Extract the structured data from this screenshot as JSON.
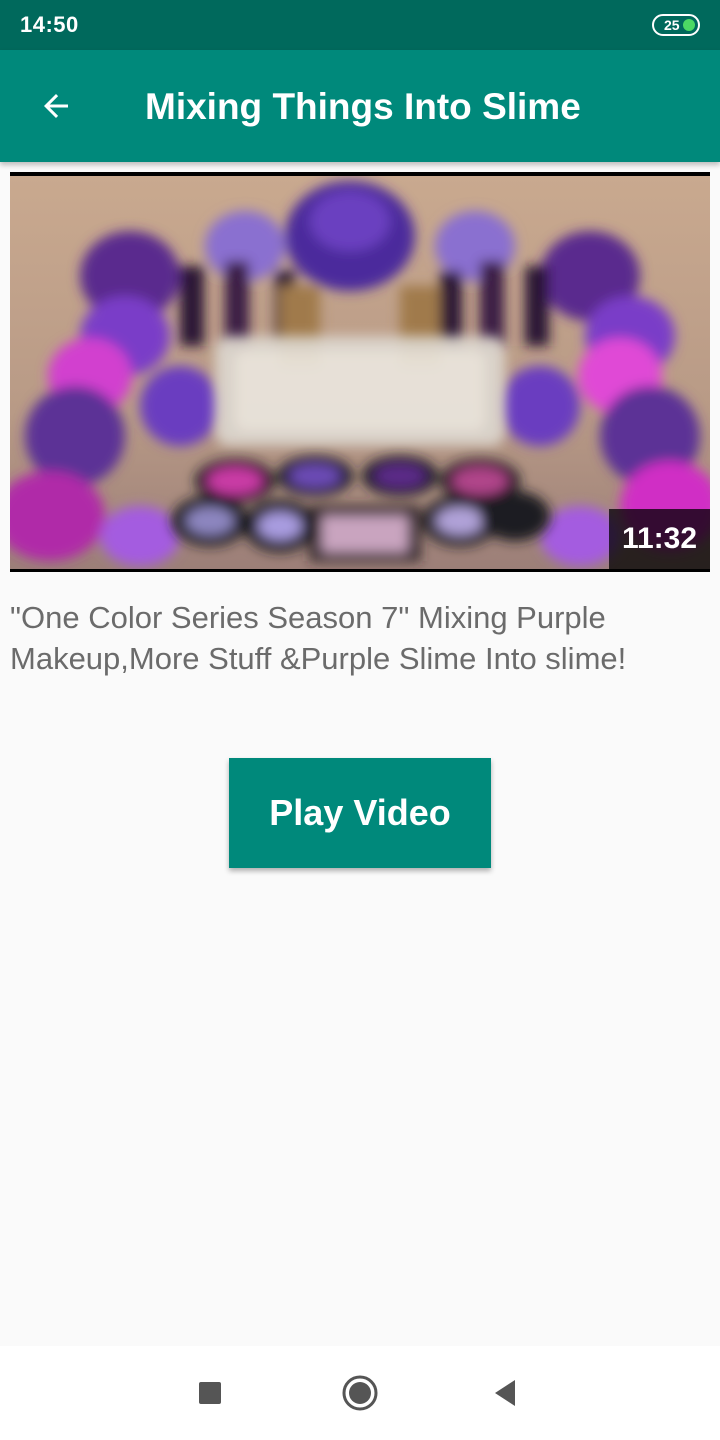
{
  "status_bar": {
    "time": "14:50",
    "battery_level": "25"
  },
  "app_bar": {
    "title": "Mixing Things Into Slime",
    "back_icon": "arrow-back-icon"
  },
  "video": {
    "duration": "11:32",
    "title": "\"One Color Series Season 7\" Mixing Purple Makeup,More Stuff &Purple Slime Into slime!"
  },
  "actions": {
    "play_label": "Play Video"
  },
  "nav_bar": {
    "icons": [
      "recents-square-icon",
      "home-circle-icon",
      "back-triangle-icon"
    ]
  },
  "colors": {
    "primary": "#00897b",
    "primary_dark": "#00695c",
    "battery_accent": "#4cd964"
  }
}
